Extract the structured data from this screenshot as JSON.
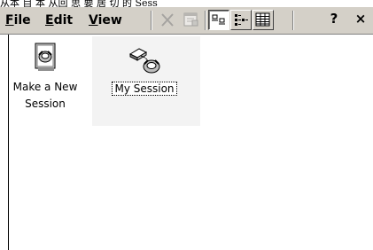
{
  "title_fragment": "从本 目 本 从回 思 要 居 切 的 Sess",
  "menu": {
    "file": "File",
    "edit": "Edit",
    "view": "View"
  },
  "toolbar": {
    "delete": "delete-icon",
    "properties": "properties-icon",
    "large_icons": "large-icons-icon",
    "small_icons": "small-icons-icon",
    "details": "details-icon",
    "help_label": "?",
    "close_label": "×"
  },
  "items": [
    {
      "label_line1": "Make a New",
      "label_line2": "Session",
      "icon": "new-session-icon",
      "selected": false
    },
    {
      "label_line1": "My Session",
      "label_line2": "",
      "icon": "session-connection-icon",
      "selected": true
    }
  ]
}
